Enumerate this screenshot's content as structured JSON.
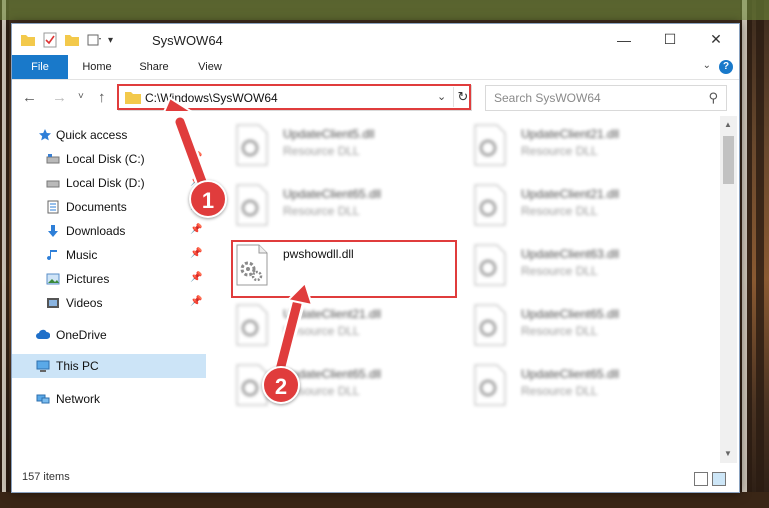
{
  "window": {
    "title": "SysWOW64",
    "minimize": "—",
    "maximize": "☐",
    "close": "✕"
  },
  "ribbon": {
    "tabs": [
      {
        "label": "File"
      },
      {
        "label": "Home"
      },
      {
        "label": "Share"
      },
      {
        "label": "View"
      }
    ],
    "help": "?"
  },
  "nav": {
    "back": "←",
    "forward": "→",
    "recent": "˅",
    "up": "↑",
    "address": "C:\\Windows\\SysWOW64",
    "search_placeholder": "Search SysWOW64"
  },
  "sidebar": {
    "items": [
      {
        "label": "Quick access",
        "icon": "star-icon"
      },
      {
        "label": "Local Disk (C:)",
        "icon": "drive-icon"
      },
      {
        "label": "Local Disk (D:)",
        "icon": "drive-icon"
      },
      {
        "label": "Documents",
        "icon": "document-icon"
      },
      {
        "label": "Downloads",
        "icon": "download-icon"
      },
      {
        "label": "Music",
        "icon": "music-icon"
      },
      {
        "label": "Pictures",
        "icon": "pictures-icon"
      },
      {
        "label": "Videos",
        "icon": "video-icon"
      },
      {
        "label": "OneDrive",
        "icon": "cloud-icon"
      },
      {
        "label": "This PC",
        "icon": "computer-icon"
      },
      {
        "label": "Network",
        "icon": "network-icon"
      }
    ]
  },
  "files": {
    "left": [
      {
        "name": "UpdateClient5.dll",
        "type": "Resource DLL"
      },
      {
        "name": "UpdateClient65.dll",
        "type": "Resource DLL"
      },
      {
        "name": "pwshowdll.dll",
        "type": ""
      },
      {
        "name": "UpdateClient21.dll",
        "type": "Resource DLL"
      },
      {
        "name": "UpdateClient65.dll",
        "type": "Resource DLL"
      }
    ],
    "right": [
      {
        "name": "UpdateClient21.dll",
        "type": "Resource DLL"
      },
      {
        "name": "UpdateClient21.dll",
        "type": "Resource DLL"
      },
      {
        "name": "UpdateClient63.dll",
        "type": "Resource DLL"
      },
      {
        "name": "UpdateClient65.dll",
        "type": "Resource DLL"
      },
      {
        "name": "UpdateClient65.dll",
        "type": "Resource DLL"
      }
    ]
  },
  "status": {
    "count": "157 items"
  },
  "annotations": {
    "step1": "1",
    "step2": "2"
  },
  "colors": {
    "accent": "#1979ca",
    "highlight": "#e03c3c",
    "selected": "#cce4f7"
  }
}
